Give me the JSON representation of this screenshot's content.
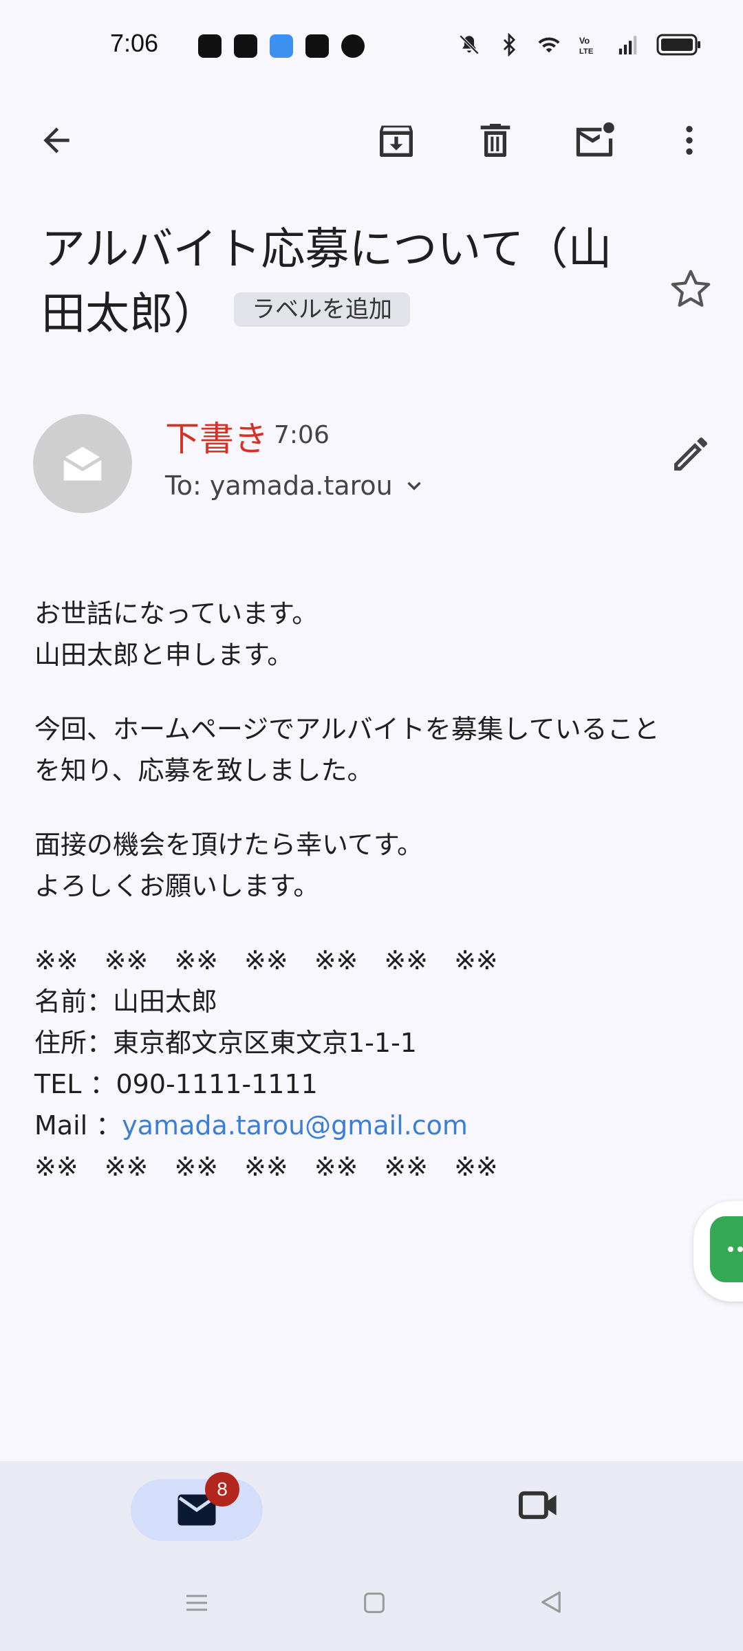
{
  "status_bar": {
    "time": "7:06",
    "app_icons": [
      "app-icon-1",
      "app-icon-2",
      "weather-icon",
      "app-icon-4",
      "cat-icon"
    ],
    "right_icons": [
      "mute-icon",
      "bluetooth-icon",
      "wifi-icon",
      "volte-icon",
      "signal-icon",
      "battery-icon"
    ]
  },
  "toolbar": {
    "back": "arrow-back-icon",
    "archive": "archive-icon",
    "delete": "trash-icon",
    "mark_unread": "mark-unread-icon",
    "more": "more-vert-icon"
  },
  "email": {
    "subject": "アルバイト応募について（山田太郎）",
    "label_button": "ラベルを追加",
    "status": "下書き",
    "time": "7:06",
    "to": "To: yamada.tarou",
    "body": {
      "greeting": "お世話になっています。\n山田太郎と申します。",
      "intro": "今回、ホームページでアルバイトを募集していること\nを知り、応募を致しました。",
      "closing": "面接の機会を頂けたら幸いてす。\nよろしくお願いします。",
      "sig_separator_top": "※※　※※　※※　※※　※※　※※　※※",
      "sig_name": "名前：山田太郎",
      "sig_address": "住所：東京都文京区東文京1-1-1",
      "sig_tel": "TEL ：090-1111-1111",
      "sig_mail_label": "Mail ：",
      "sig_mail": "yamada.tarou@gmail.com",
      "sig_separator_bottom": "※※　※※　※※　※※　※※　※※　※※"
    }
  },
  "bottom_nav": {
    "mail_badge": "8"
  },
  "colors": {
    "draft_red": "#d93025",
    "link_blue": "#3b7ed6",
    "fab_green": "#34a853",
    "badge_red": "#b3261e"
  }
}
